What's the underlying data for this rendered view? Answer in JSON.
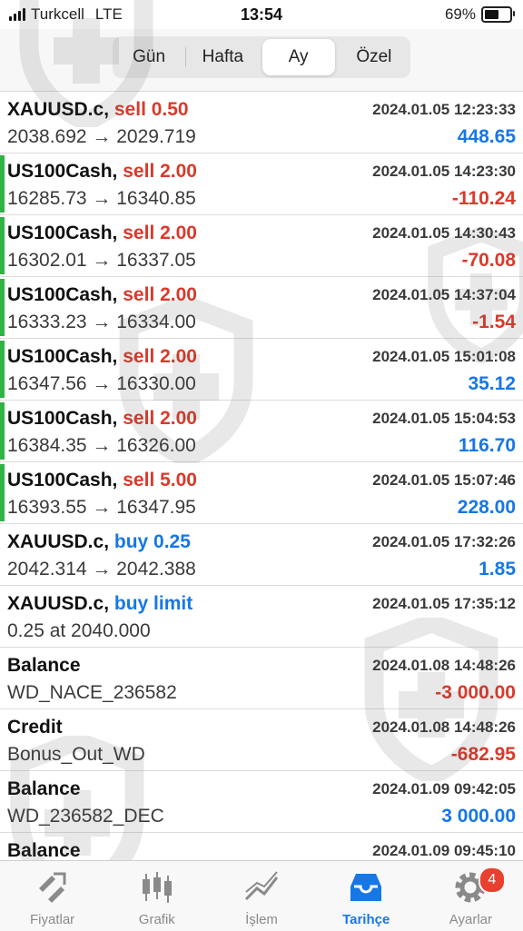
{
  "status_bar": {
    "carrier": "Turkcell",
    "network": "LTE",
    "time": "13:54",
    "battery_percent": "69%",
    "battery_level": 0.69
  },
  "segments": [
    {
      "label": "Gün",
      "active": false
    },
    {
      "label": "Hafta",
      "active": false
    },
    {
      "label": "Ay",
      "active": true
    },
    {
      "label": "Özel",
      "active": false
    }
  ],
  "colors": {
    "sell": "#d93a2b",
    "buy": "#1677e6",
    "positive": "#1677e6",
    "negative": "#d93a2b",
    "active_tab": "#1677e6",
    "side_bar": "#2fb344"
  },
  "history": [
    {
      "symbol": "XAUUSD.c,",
      "side": "sell 0.50",
      "side_type": "sell",
      "time": "2024.01.05 12:23:33",
      "prices": "2038.692 → 2029.719",
      "profit": "448.65",
      "profit_type": "pos",
      "bar": false
    },
    {
      "symbol": "US100Cash,",
      "side": "sell 2.00",
      "side_type": "sell",
      "time": "2024.01.05 14:23:30",
      "prices": "16285.73 → 16340.85",
      "profit": "-110.24",
      "profit_type": "neg",
      "bar": true
    },
    {
      "symbol": "US100Cash,",
      "side": "sell 2.00",
      "side_type": "sell",
      "time": "2024.01.05 14:30:43",
      "prices": "16302.01 → 16337.05",
      "profit": "-70.08",
      "profit_type": "neg",
      "bar": true
    },
    {
      "symbol": "US100Cash,",
      "side": "sell 2.00",
      "side_type": "sell",
      "time": "2024.01.05 14:37:04",
      "prices": "16333.23 → 16334.00",
      "profit": "-1.54",
      "profit_type": "neg",
      "bar": true
    },
    {
      "symbol": "US100Cash,",
      "side": "sell 2.00",
      "side_type": "sell",
      "time": "2024.01.05 15:01:08",
      "prices": "16347.56 → 16330.00",
      "profit": "35.12",
      "profit_type": "pos",
      "bar": true
    },
    {
      "symbol": "US100Cash,",
      "side": "sell 2.00",
      "side_type": "sell",
      "time": "2024.01.05 15:04:53",
      "prices": "16384.35 → 16326.00",
      "profit": "116.70",
      "profit_type": "pos",
      "bar": true
    },
    {
      "symbol": "US100Cash,",
      "side": "sell 5.00",
      "side_type": "sell",
      "time": "2024.01.05 15:07:46",
      "prices": "16393.55 → 16347.95",
      "profit": "228.00",
      "profit_type": "pos",
      "bar": true
    },
    {
      "symbol": "XAUUSD.c,",
      "side": "buy 0.25",
      "side_type": "buy",
      "time": "2024.01.05 17:32:26",
      "prices": "2042.314 → 2042.388",
      "profit": "1.85",
      "profit_type": "pos",
      "bar": false
    },
    {
      "symbol": "XAUUSD.c,",
      "side": "buy limit",
      "side_type": "buy",
      "time": "2024.01.05 17:35:12",
      "prices": "0.25 at 2040.000",
      "profit": "",
      "profit_type": "pos",
      "bar": false
    },
    {
      "symbol": "Balance",
      "side": "",
      "side_type": "",
      "time": "2024.01.08 14:48:26",
      "prices": "WD_NACE_236582",
      "profit": "-3 000.00",
      "profit_type": "neg",
      "bar": false
    },
    {
      "symbol": "Credit",
      "side": "",
      "side_type": "",
      "time": "2024.01.08 14:48:26",
      "prices": "Bonus_Out_WD",
      "profit": "-682.95",
      "profit_type": "neg",
      "bar": false
    },
    {
      "symbol": "Balance",
      "side": "",
      "side_type": "",
      "time": "2024.01.09 09:42:05",
      "prices": "WD_236582_DEC",
      "profit": "3 000.00",
      "profit_type": "pos",
      "bar": false
    },
    {
      "symbol": "Balance",
      "side": "",
      "side_type": "",
      "time": "2024.01.09 09:45:10",
      "prices": "",
      "profit": "",
      "profit_type": "pos",
      "bar": false
    }
  ],
  "tabs": [
    {
      "label": "Fiyatlar",
      "icon": "quotes-icon",
      "active": false
    },
    {
      "label": "Grafik",
      "icon": "chart-icon",
      "active": false
    },
    {
      "label": "İşlem",
      "icon": "trade-icon",
      "active": false
    },
    {
      "label": "Tarihçe",
      "icon": "history-icon",
      "active": true
    },
    {
      "label": "Ayarlar",
      "icon": "settings-icon",
      "active": false,
      "badge": "4"
    }
  ]
}
